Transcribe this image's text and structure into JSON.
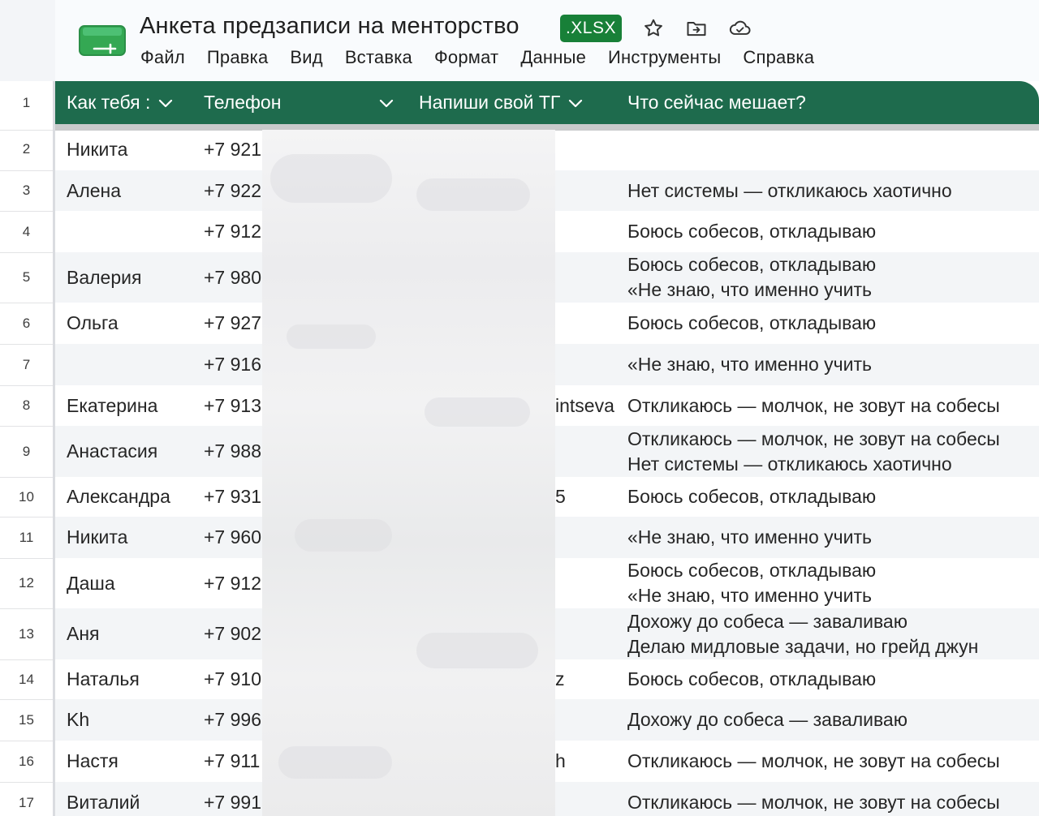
{
  "doc": {
    "title": "Анкета предзаписи на менторство",
    "format_badge": ".XLSX",
    "brand_color": "#1e6b4d",
    "badge_color": "#188038",
    "icons": [
      "star-icon",
      "move-to-folder-icon",
      "cloud-status-icon"
    ]
  },
  "menu": [
    "Файл",
    "Правка",
    "Вид",
    "Вставка",
    "Формат",
    "Данные",
    "Инструменты",
    "Справка"
  ],
  "header": {
    "row_number": "1",
    "columns": [
      "Как тебя :",
      "Телефон",
      "Напиши свой ТГ",
      "Что сейчас мешает?"
    ]
  },
  "rows": [
    {
      "num": "2",
      "name": "Никита",
      "phone": "+7 921",
      "tg": "",
      "problem": []
    },
    {
      "num": "3",
      "name": "Алена",
      "phone": "+7 922",
      "tg": "",
      "problem": [
        "Нет системы — откликаюсь хаотично"
      ]
    },
    {
      "num": "4",
      "name": "",
      "phone": "+7 912",
      "tg": "",
      "problem": [
        "Боюсь собесов, откладываю"
      ]
    },
    {
      "num": "5",
      "name": "Валерия",
      "phone": "+7 980",
      "tg": "",
      "problem": [
        "Боюсь собесов, откладываю",
        "«Не знаю, что именно учить"
      ]
    },
    {
      "num": "6",
      "name": "Ольга",
      "phone": "+7 927",
      "tg": "",
      "problem": [
        "Боюсь собесов, откладываю"
      ]
    },
    {
      "num": "7",
      "name": "",
      "phone": "+7 916",
      "tg": "",
      "problem": [
        "«Не знаю, что именно учить"
      ]
    },
    {
      "num": "8",
      "name": "Екатерина",
      "phone": "+7 913",
      "tg": "intseva",
      "problem": [
        "Откликаюсь — молчок, не зовут на собесы"
      ]
    },
    {
      "num": "9",
      "name": "Анастасия",
      "phone": "+7 988",
      "tg": "",
      "problem": [
        "Откликаюсь — молчок, не зовут на собесы",
        "Нет системы — откликаюсь хаотично"
      ]
    },
    {
      "num": "10",
      "name": "Александра",
      "phone": "+7 931",
      "tg": "5",
      "problem": [
        "Боюсь собесов, откладываю"
      ]
    },
    {
      "num": "11",
      "name": "Никита",
      "phone": "+7 960",
      "tg": "",
      "problem": [
        "«Не знаю, что именно учить"
      ]
    },
    {
      "num": "12",
      "name": "Даша",
      "phone": "+7 912",
      "tg": "",
      "problem": [
        "Боюсь собесов, откладываю",
        "«Не знаю, что именно учить"
      ]
    },
    {
      "num": "13",
      "name": "Аня",
      "phone": "+7 902",
      "tg": "",
      "problem": [
        "Дохожу до собеса — заваливаю",
        "Делаю мидловые задачи, но грейд джун"
      ]
    },
    {
      "num": "14",
      "name": "Наталья",
      "phone": "+7 910",
      "tg": "z",
      "problem": [
        "Боюсь собесов, откладываю"
      ]
    },
    {
      "num": "15",
      "name": "Kh",
      "phone": "+7 996",
      "tg": "",
      "problem": [
        "Дохожу до собеса — заваливаю"
      ]
    },
    {
      "num": "16",
      "name": "Настя",
      "phone": "+7 911",
      "tg": "h",
      "problem": [
        "Откликаюсь — молчок, не зовут на собесы"
      ]
    },
    {
      "num": "17",
      "name": "Виталий",
      "phone": "+7 991",
      "tg": "",
      "problem": [
        "Откликаюсь — молчок, не зовут на собесы"
      ]
    }
  ]
}
